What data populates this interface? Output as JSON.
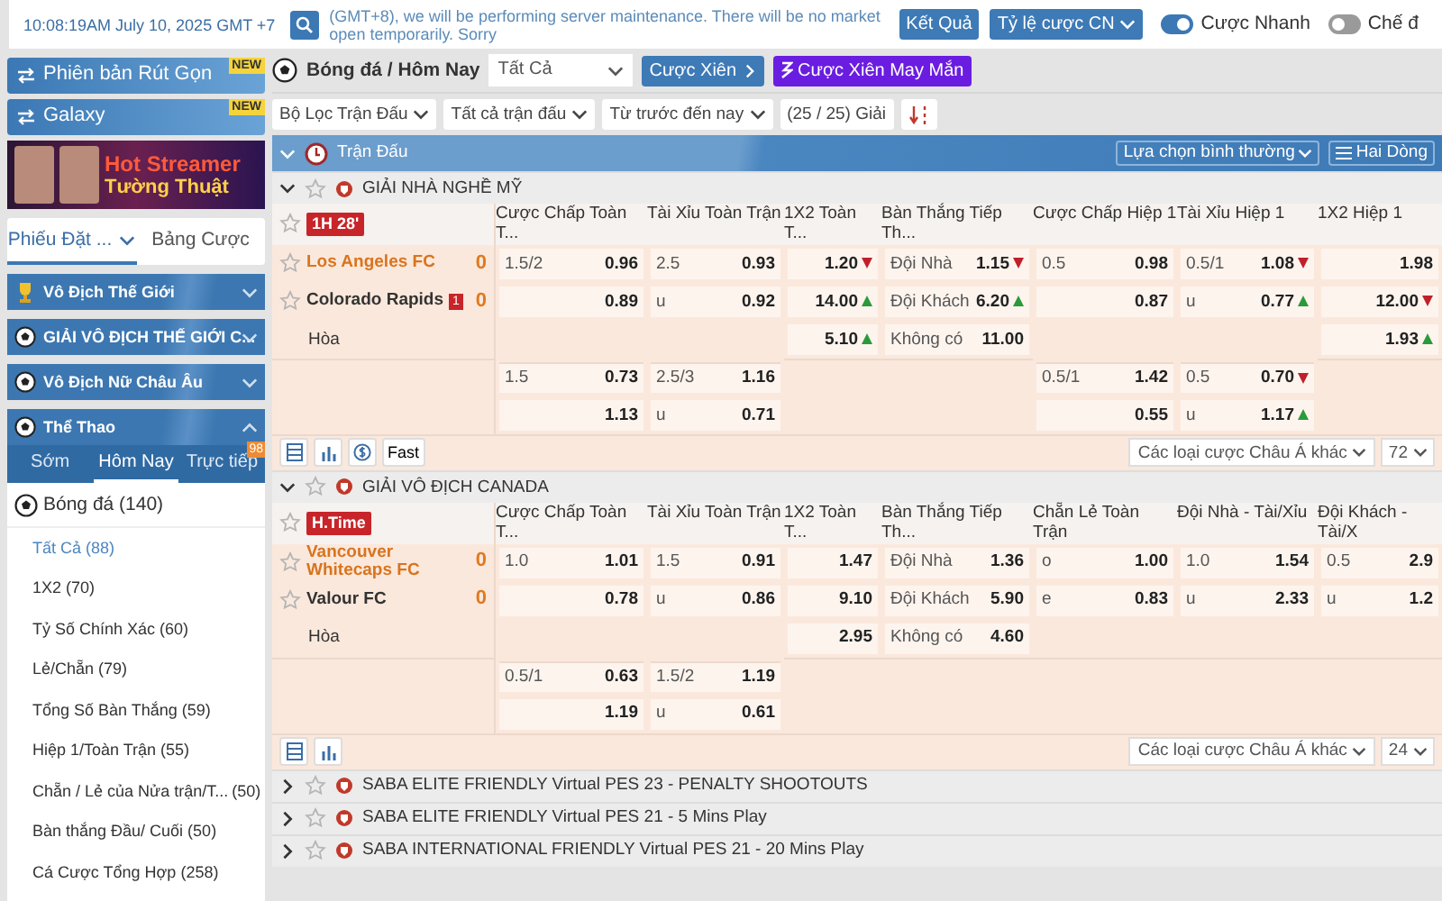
{
  "top_bar": {
    "datetime": "10:08:19AM July 10, 2025 GMT +7",
    "notice": "(GMT+8), we will be performing server maintenance. There will be no market open temporarily. Sorry",
    "results_button": "Kết Quả",
    "odds_dropdown": "Tỷ lệ cược CN",
    "toggles": [
      {
        "label": "Cược Nhanh",
        "on": true
      },
      {
        "label": "Chế đ",
        "on": false
      }
    ]
  },
  "sidebar": {
    "version_buttons": [
      {
        "label": "Phiên bản Rút Gọn",
        "badge": "NEW"
      },
      {
        "label": "Galaxy",
        "badge": "NEW"
      }
    ],
    "banner": {
      "line_1": "Hot Streamer",
      "line_2": "Tường Thuật"
    },
    "tabs": [
      {
        "label": "Phiếu Đặt ...",
        "selected": true
      },
      {
        "label": "Bảng Cược",
        "selected": false
      }
    ],
    "sections": [
      {
        "title": "Vô Địch Thế Giới",
        "expanded": false
      },
      {
        "title": "GIẢI VÔ ĐỊCH THẾ GIỚI C...",
        "expanded": false
      },
      {
        "title": "Vô Địch Nữ Châu Âu",
        "expanded": false
      },
      {
        "title": "Thể Thao",
        "expanded": true,
        "subtabs": [
          {
            "label": "Sớm",
            "selected": false
          },
          {
            "label": "Hôm Nay",
            "selected": true
          },
          {
            "label": "Trực tiếp",
            "selected": false,
            "badge": "98"
          }
        ],
        "sport": {
          "name": "Bóng đá",
          "count": "(140)"
        },
        "items": [
          {
            "label": "Tất Cả",
            "count": "(88)",
            "selected": true
          },
          {
            "label": "1X2",
            "count": "(70)",
            "selected": false
          },
          {
            "label": "Tỷ Số Chính Xác",
            "count": "(60)",
            "selected": false
          },
          {
            "label": "Lẻ/Chẵn",
            "count": "(79)",
            "selected": false
          },
          {
            "label": "Tổng Số Bàn Thắng",
            "count": "(59)",
            "selected": false
          },
          {
            "label": "Hiệp 1/Toàn Trận",
            "count": "(55)",
            "selected": false
          },
          {
            "label": "Chẵn / Lẻ của Nửa trận/T...",
            "count": "(50)",
            "selected": false
          },
          {
            "label": "Bàn thắng Đầu/ Cuối",
            "count": "(50)",
            "selected": false
          },
          {
            "label": "Cá Cược Tổng Hợp",
            "count": "(258)",
            "selected": false
          }
        ]
      }
    ]
  },
  "main": {
    "breadcrumb": "Bóng đá / Hôm Nay",
    "market_select": "Tất Cả",
    "parlay_button": "Cược Xiên",
    "lucky_parlay_button": "Cược Xiên May Mắn",
    "filters": [
      "Bộ Lọc Trận Đấu",
      "Tất cả trận đấu",
      "Từ trước đến nay"
    ],
    "league_count": "(25 / 25) Giải",
    "header_bar": {
      "title": "Trận Đấu",
      "view_select": "Lựa chọn bình thường",
      "rows_select": "Hai Dòng"
    },
    "leagues": [
      {
        "name": "GIẢI NHÀ NGHỀ MỸ",
        "expanded": true,
        "matches": [
          {
            "status": "1H 28'",
            "columns": [
              "Cược Chấp Toàn T...",
              "Tài Xỉu Toàn Trận",
              "1X2 Toàn T...",
              "Bàn Thắng Tiếp Th...",
              "Cược Chấp Hiệp 1",
              "Tài Xỉu Hiệp 1",
              "1X2 Hiệp 1"
            ],
            "home": {
              "name": "Los Angeles FC",
              "score": "0"
            },
            "away": {
              "name": "Colorado Rapids",
              "score": "0",
              "red_cards": "1"
            },
            "draw": "Hòa",
            "lines": [
              [
                [
                  {
                    "kind": "odds",
                    "label": "1.5/2",
                    "value": "0.96"
                  },
                  {
                    "kind": "odds",
                    "label": "2.5",
                    "value": "0.93"
                  },
                  {
                    "kind": "odds",
                    "value": "1.20",
                    "up": false
                  },
                  {
                    "kind": "odds",
                    "label": "Đội Nhà",
                    "value": "1.15",
                    "up": false
                  },
                  {
                    "kind": "odds",
                    "label": "0.5",
                    "value": "0.98"
                  },
                  {
                    "kind": "odds",
                    "label": "0.5/1",
                    "value": "1.08",
                    "up": false
                  },
                  {
                    "kind": "odds",
                    "value": "1.98"
                  }
                ],
                [
                  {
                    "kind": "odds",
                    "value": "0.89"
                  },
                  {
                    "kind": "odds",
                    "label": "u",
                    "value": "0.92"
                  },
                  {
                    "kind": "odds",
                    "value": "14.00",
                    "up": true
                  },
                  {
                    "kind": "odds",
                    "label": "Đội Khách",
                    "value": "6.20",
                    "up": true
                  },
                  {
                    "kind": "odds",
                    "value": "0.87"
                  },
                  {
                    "kind": "odds",
                    "label": "u",
                    "value": "0.77",
                    "up": true
                  },
                  {
                    "kind": "odds",
                    "value": "12.00",
                    "up": false
                  }
                ],
                [
                  {
                    "kind": "blank"
                  },
                  {
                    "kind": "blank"
                  },
                  {
                    "kind": "odds",
                    "value": "5.10",
                    "up": true
                  },
                  {
                    "kind": "odds",
                    "label": "Không có",
                    "value": "11.00"
                  },
                  {
                    "kind": "blank"
                  },
                  {
                    "kind": "blank"
                  },
                  {
                    "kind": "odds",
                    "value": "1.93",
                    "up": true
                  }
                ]
              ],
              [
                [
                  {
                    "kind": "odds",
                    "label": "1.5",
                    "value": "0.73"
                  },
                  {
                    "kind": "odds",
                    "label": "2.5/3",
                    "value": "1.16"
                  },
                  {
                    "kind": "blank"
                  },
                  {
                    "kind": "blank"
                  },
                  {
                    "kind": "odds",
                    "label": "0.5/1",
                    "value": "1.42"
                  },
                  {
                    "kind": "odds",
                    "label": "0.5",
                    "value": "0.70",
                    "up": false
                  },
                  {
                    "kind": "blank"
                  }
                ],
                [
                  {
                    "kind": "odds",
                    "value": "1.13"
                  },
                  {
                    "kind": "odds",
                    "label": "u",
                    "value": "0.71"
                  },
                  {
                    "kind": "blank"
                  },
                  {
                    "kind": "blank"
                  },
                  {
                    "kind": "odds",
                    "value": "0.55"
                  },
                  {
                    "kind": "odds",
                    "label": "u",
                    "value": "1.17",
                    "up": true
                  },
                  {
                    "kind": "blank"
                  }
                ]
              ]
            ],
            "tools": [
              {
                "kind": "list"
              },
              {
                "kind": "chart"
              },
              {
                "kind": "currency"
              },
              {
                "kind": "text",
                "label": "Fast"
              }
            ],
            "more_markets": "Các loại cược Châu Á khác",
            "market_count": "72"
          }
        ]
      },
      {
        "name": "GIẢI VÔ ĐỊCH CANADA",
        "expanded": true,
        "matches": [
          {
            "status": "H.Time",
            "columns": [
              "Cược Chấp Toàn T...",
              "Tài Xỉu Toàn Trận",
              "1X2 Toàn T...",
              "Bàn Thắng Tiếp Th...",
              "Chẵn Lẻ Toàn Trận",
              "Đội Nhà - Tài/Xỉu",
              "Đội Khách - Tài/X"
            ],
            "home": {
              "name": "Vancouver Whitecaps FC",
              "score": "0"
            },
            "away": {
              "name": "Valour FC",
              "score": "0"
            },
            "draw": "Hòa",
            "lines": [
              [
                [
                  {
                    "kind": "odds",
                    "label": "1.0",
                    "value": "1.01"
                  },
                  {
                    "kind": "odds",
                    "label": "1.5",
                    "value": "0.91"
                  },
                  {
                    "kind": "odds",
                    "value": "1.47"
                  },
                  {
                    "kind": "odds",
                    "label": "Đội Nhà",
                    "value": "1.36"
                  },
                  {
                    "kind": "odds",
                    "label": "o",
                    "value": "1.00"
                  },
                  {
                    "kind": "odds",
                    "label": "1.0",
                    "value": "1.54"
                  },
                  {
                    "kind": "odds",
                    "label": "0.5",
                    "value": "2.9"
                  }
                ],
                [
                  {
                    "kind": "odds",
                    "value": "0.78"
                  },
                  {
                    "kind": "odds",
                    "label": "u",
                    "value": "0.86"
                  },
                  {
                    "kind": "odds",
                    "value": "9.10"
                  },
                  {
                    "kind": "odds",
                    "label": "Đội Khách",
                    "value": "5.90"
                  },
                  {
                    "kind": "odds",
                    "label": "e",
                    "value": "0.83"
                  },
                  {
                    "kind": "odds",
                    "label": "u",
                    "value": "2.33"
                  },
                  {
                    "kind": "odds",
                    "label": "u",
                    "value": "1.2"
                  }
                ],
                [
                  {
                    "kind": "blank"
                  },
                  {
                    "kind": "blank"
                  },
                  {
                    "kind": "odds",
                    "value": "2.95"
                  },
                  {
                    "kind": "odds",
                    "label": "Không có",
                    "value": "4.60"
                  },
                  {
                    "kind": "blank"
                  },
                  {
                    "kind": "blank"
                  },
                  {
                    "kind": "blank"
                  }
                ]
              ],
              [
                [
                  {
                    "kind": "odds",
                    "label": "0.5/1",
                    "value": "0.63"
                  },
                  {
                    "kind": "odds",
                    "label": "1.5/2",
                    "value": "1.19"
                  },
                  {
                    "kind": "blank"
                  },
                  {
                    "kind": "blank"
                  },
                  {
                    "kind": "blank"
                  },
                  {
                    "kind": "blank"
                  },
                  {
                    "kind": "blank"
                  }
                ],
                [
                  {
                    "kind": "odds",
                    "value": "1.19"
                  },
                  {
                    "kind": "odds",
                    "label": "u",
                    "value": "0.61"
                  },
                  {
                    "kind": "blank"
                  },
                  {
                    "kind": "blank"
                  },
                  {
                    "kind": "blank"
                  },
                  {
                    "kind": "blank"
                  },
                  {
                    "kind": "blank"
                  }
                ]
              ]
            ],
            "tools": [
              {
                "kind": "list"
              },
              {
                "kind": "chart"
              }
            ],
            "more_markets": "Các loại cược Châu Á khác",
            "market_count": "24"
          }
        ]
      },
      {
        "name": "SABA ELITE FRIENDLY Virtual PES 23 - PENALTY SHOOTOUTS",
        "expanded": false
      },
      {
        "name": "SABA ELITE FRIENDLY Virtual PES 21 - 5 Mins Play",
        "expanded": false
      },
      {
        "name": "SABA INTERNATIONAL FRIENDLY Virtual PES 21 - 20 Mins Play",
        "expanded": false
      }
    ]
  }
}
